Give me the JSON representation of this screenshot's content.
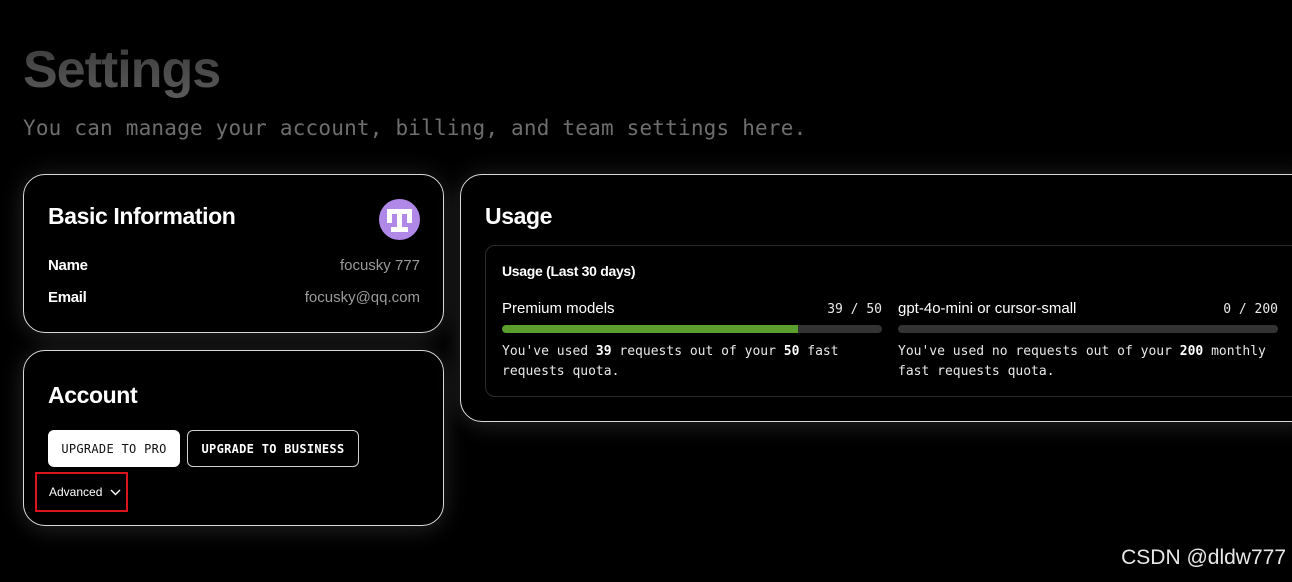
{
  "header": {
    "title": "Settings",
    "subtitle": "You can manage your account, billing, and team settings here."
  },
  "basic_info": {
    "title": "Basic Information",
    "avatar_icon": "identicon-avatar",
    "avatar_color": "#b088e8",
    "name_label": "Name",
    "name_value": "focusky 777",
    "email_label": "Email",
    "email_value": "focusky@qq.com"
  },
  "account": {
    "title": "Account",
    "upgrade_pro_label": "UPGRADE TO PRO",
    "upgrade_business_label": "UPGRADE TO BUSINESS",
    "advanced_label": "Advanced",
    "advanced_icon": "chevron-down-icon",
    "highlight_color": "#d9141c"
  },
  "usage": {
    "title": "Usage",
    "period_title": "Usage (Last 30 days)",
    "meters": [
      {
        "label": "Premium models",
        "count": "39 / 50",
        "used": 39,
        "limit": 50,
        "bar_color": "#5c9e2e",
        "desc_pre": "You've used ",
        "desc_used": "39",
        "desc_mid": " requests out of your ",
        "desc_limit": "50",
        "desc_post": " fast requests quota."
      },
      {
        "label": "gpt-4o-mini or cursor-small",
        "count": "0 / 200",
        "used": 0,
        "limit": 200,
        "bar_color": "#5c9e2e",
        "desc_pre": "You've used no requests out of your ",
        "desc_limit": "200",
        "desc_post": " monthly fast requests quota."
      }
    ]
  },
  "watermark": "CSDN @dldw777"
}
